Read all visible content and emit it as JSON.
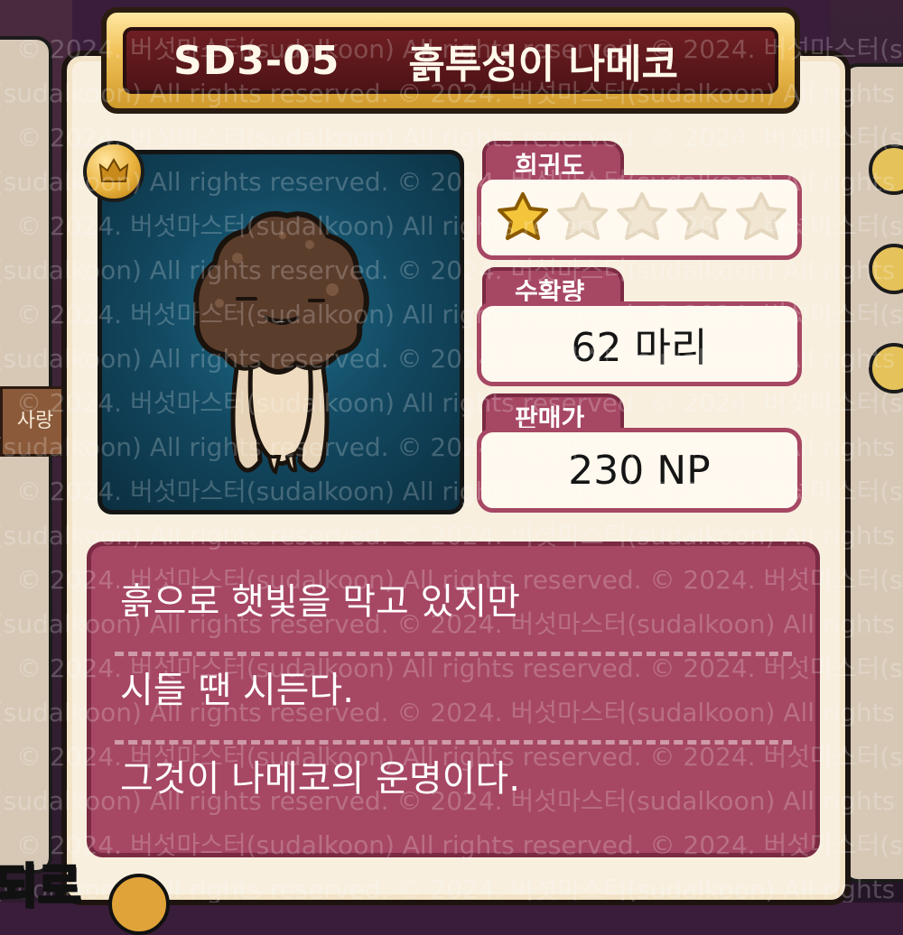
{
  "card": {
    "code": "SD3-05",
    "name": "흙투성이 나메코"
  },
  "rarity": {
    "label": "희귀도",
    "filled": 1,
    "max": 5
  },
  "harvest": {
    "label": "수확량",
    "value": "62 마리"
  },
  "price": {
    "label": "판매가",
    "value": "230 NP"
  },
  "description": {
    "lines": [
      "흙으로 햇빛을 막고 있지만",
      "시들 땐 시든다.",
      "그것이 나메코의 운명이다."
    ]
  },
  "background": {
    "left_tab": "사랑",
    "corner": "되로"
  },
  "watermark": "© 2024. 버섯마스터(sudalkoon) All rights reserved.",
  "colors": {
    "accent": "#a64763",
    "title_bg": "#5a1a1d",
    "gold": "#e6b54a",
    "portrait_bg": "#134a63"
  }
}
